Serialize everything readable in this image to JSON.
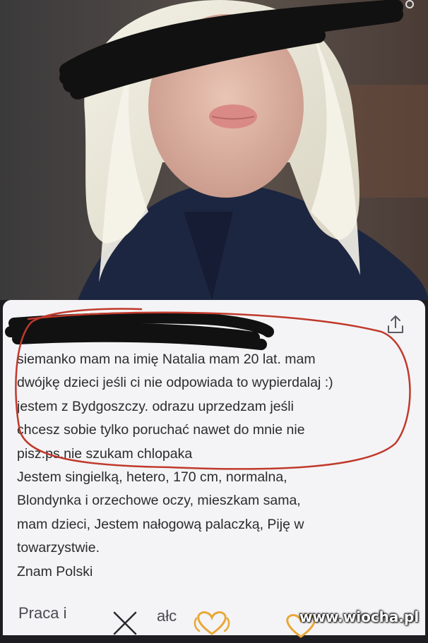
{
  "profile": {
    "bio_lines": [
      "siemanko mam na imię Natalia mam 20 lat. mam",
      "dwójkę dzieci jeśli ci nie odpowiada to wypierdalaj :)",
      "jestem z Bydgoszczy. odrazu uprzedzam jeśli",
      "chcesz sobie tylko poruchać nawet do mnie nie",
      "pisz.ps.nie szukam chlopaka"
    ],
    "details_lines": [
      "Jestem singielką, hetero, 170 cm, normalna,",
      "Blondynka i orzechowe oczy, mieszkam sama,",
      "mam dzieci, Jestem nałogową palaczką, Piję w",
      "towarzystwie.",
      "Znam Polski"
    ],
    "section_label": "Praca i",
    "section_label_2": "ałc"
  },
  "icons": {
    "share": "share-icon",
    "dislike": "close-icon",
    "like": "heart-icon",
    "overflow": "more-dots-icon"
  },
  "colors": {
    "annotation_circle": "#c0392b",
    "like_heart": "#e8a838",
    "card_background": "#f4f4f6",
    "redaction": "#111111"
  },
  "watermark": {
    "text": "www.wiocha.pl"
  }
}
